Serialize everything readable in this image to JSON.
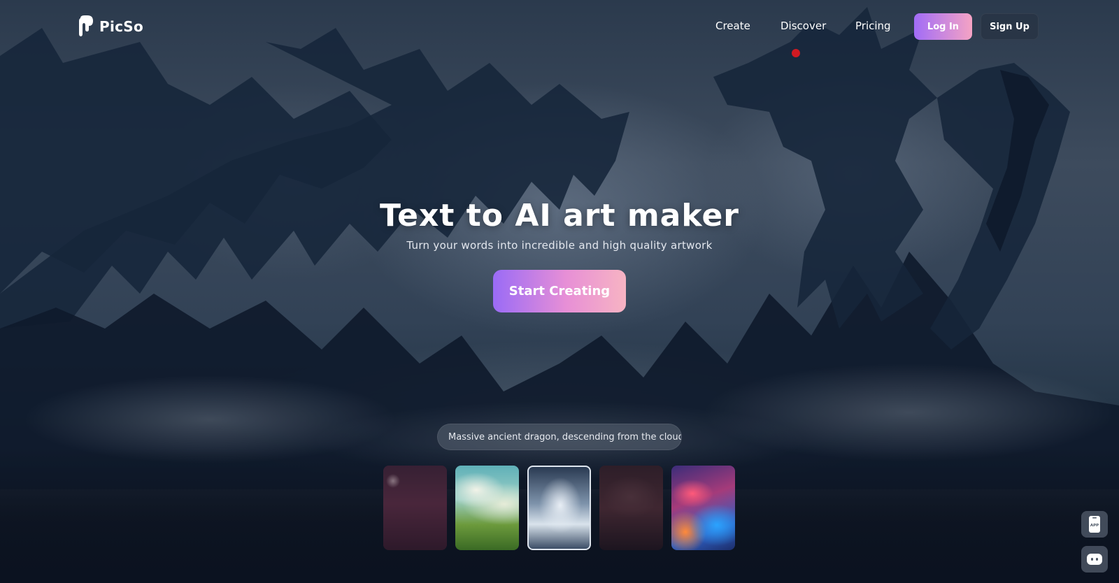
{
  "brand": {
    "name": "PicSo"
  },
  "nav": {
    "create": "Create",
    "discover": "Discover",
    "pricing": "Pricing"
  },
  "auth": {
    "login": "Log In",
    "signup": "Sign Up"
  },
  "hero": {
    "title": "Text to AI art maker",
    "subtitle": "Turn your words into incredible and high quality artwork",
    "cta": "Start Creating"
  },
  "prompt": {
    "text": "Massive ancient dragon, descending from the clouds"
  },
  "thumbnails": [
    {
      "name": "gothic-interior"
    },
    {
      "name": "green-landscape"
    },
    {
      "name": "dragon-clouds",
      "active": true
    },
    {
      "name": "crowd-hall"
    },
    {
      "name": "abstract-colors"
    }
  ],
  "floating": {
    "app_label": "APP"
  },
  "colors": {
    "accent_start": "#9a6bf6",
    "accent_end": "#f7b4c3",
    "bg_dark": "#0b1220"
  }
}
